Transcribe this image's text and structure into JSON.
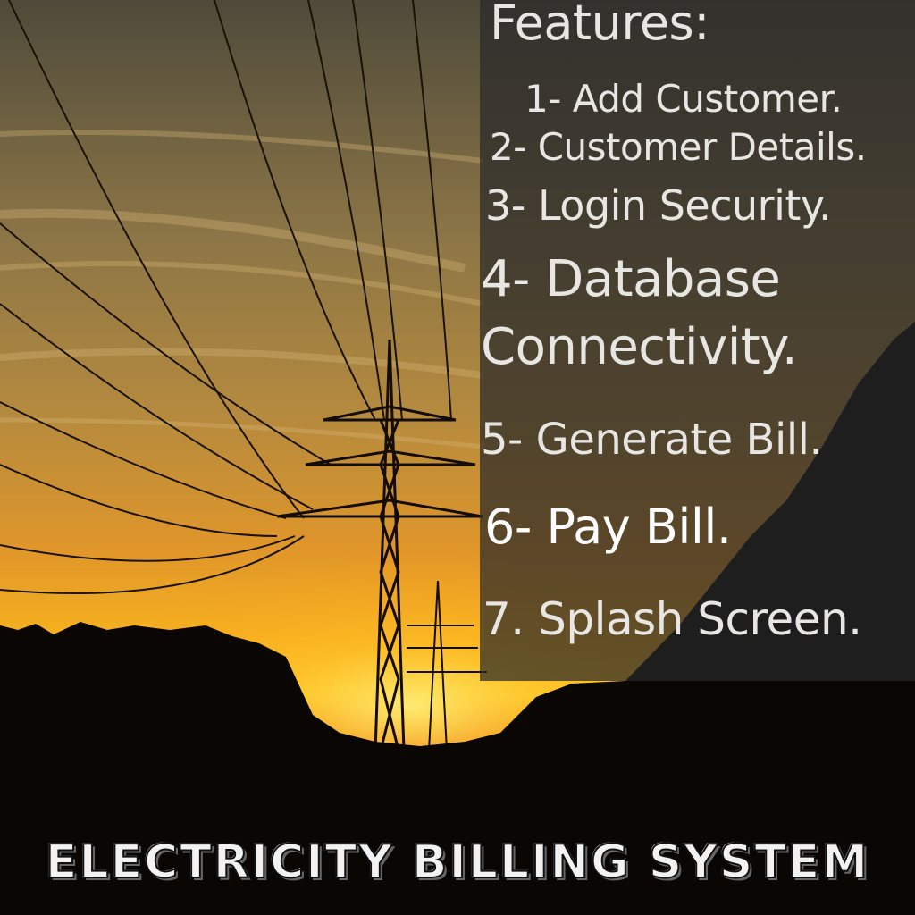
{
  "features": {
    "heading": "Features:",
    "items": [
      "1- Add Customer.",
      "2- Customer Details.",
      "3- Login Security.",
      "4- Database",
      "Connectivity.",
      "5- Generate Bill.",
      "6- Pay Bill.",
      "7. Splash Screen."
    ]
  },
  "banner": {
    "title": "ELECTRICITY BILLING SYSTEM"
  },
  "colors": {
    "sky_top": "#4a4a3c",
    "sky_mid": "#b08a3c",
    "sunset": "#f5a623",
    "glow": "#ffd23a",
    "silhouette": "#0a0604",
    "panel": "#282828",
    "text": "#e8e6e3"
  }
}
